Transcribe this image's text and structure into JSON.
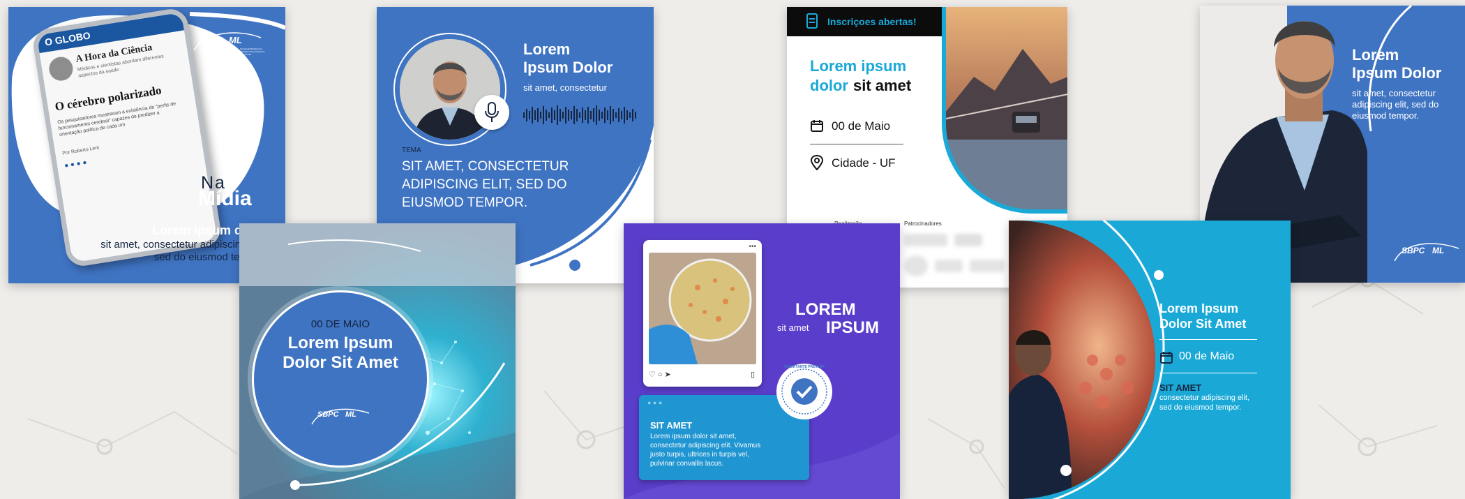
{
  "brand": {
    "logo_text": "SBPC",
    "logo_text_2": "ML",
    "logo_subtitle": "Sociedade Brasileira de Patologia Clínica Medicina Laboratorial"
  },
  "colors": {
    "brand_blue": "#3f74c3",
    "cyan": "#1aa9d7",
    "purple": "#5a3ecb",
    "ink": "#16253f",
    "white": "#ffffff"
  },
  "card_a": {
    "newspaper_name": "O GLOBO",
    "column_title": "A Hora da Ciência",
    "column_blurb": "Médicos e cientistas abordam diferentes aspectos da saúde",
    "headline": "O cérebro polarizado",
    "body": "Os pesquisadores mostraram a existência de \"perfis de funcionamento cerebral\" capazes de predizer a orientação política de cada um",
    "byline": "Por Roberto Lent",
    "na": "Na",
    "midia": "Mídia",
    "title": "Lorem ipsum dolor",
    "subtitle_1": "sit amet, consectetur adipiscing elit,",
    "subtitle_2": "sed do eiusmod tempor."
  },
  "card_b": {
    "title_1": "Lorem",
    "title_2": "Ipsum Dolor",
    "subtitle": "sit amet, consectetur",
    "tema_label": "TEMA",
    "tema_1": "SIT AMET, CONSECTETUR",
    "tema_2": "ADIPISCING ELIT, SED DO",
    "tema_3": "EIUSMOD TEMPOR.",
    "mic_icon": "microphone-icon"
  },
  "card_c": {
    "banner": "Inscriçoes abertas!",
    "title_1a": "Lorem ipsum",
    "title_2a": "dolor",
    "title_2b": "sit amet",
    "date": "00 de Maio",
    "location": "Cidade - UF",
    "realizacao": "Realização",
    "patrocinadores": "Patrocinadores"
  },
  "card_d": {
    "title_1": "Lorem",
    "title_2": "Ipsum Dolor",
    "sub_1": "sit amet, consectetur",
    "sub_2": "adipiscing elit, sed do",
    "sub_3": "eiusmod tempor."
  },
  "card_e": {
    "date": "00 DE MAIO",
    "title_1": "Lorem Ipsum",
    "title_2": "Dolor Sit Amet"
  },
  "card_f": {
    "title_1": "LOREM",
    "title_small": "sit amet",
    "title_2": "IPSUM",
    "seal_text": "IMPORTANTE PREVINIR",
    "box_title": "SIT AMET",
    "box_1": "Lorem ipsum dolor sit amet,",
    "box_2": "consectetur adipiscing elit. Vivamus",
    "box_3": "justo turpis, ultrices in turpis vel,",
    "box_4": "pulvinar convallis lacus."
  },
  "card_g": {
    "title_1": "Lorem Ipsum",
    "title_2": "Dolor Sit Amet",
    "date": "00 de Maio",
    "sub_title": "SIT AMET",
    "sub_1": "consectetur adipiscing elit,",
    "sub_2": "sed do eiusmod tempor."
  }
}
